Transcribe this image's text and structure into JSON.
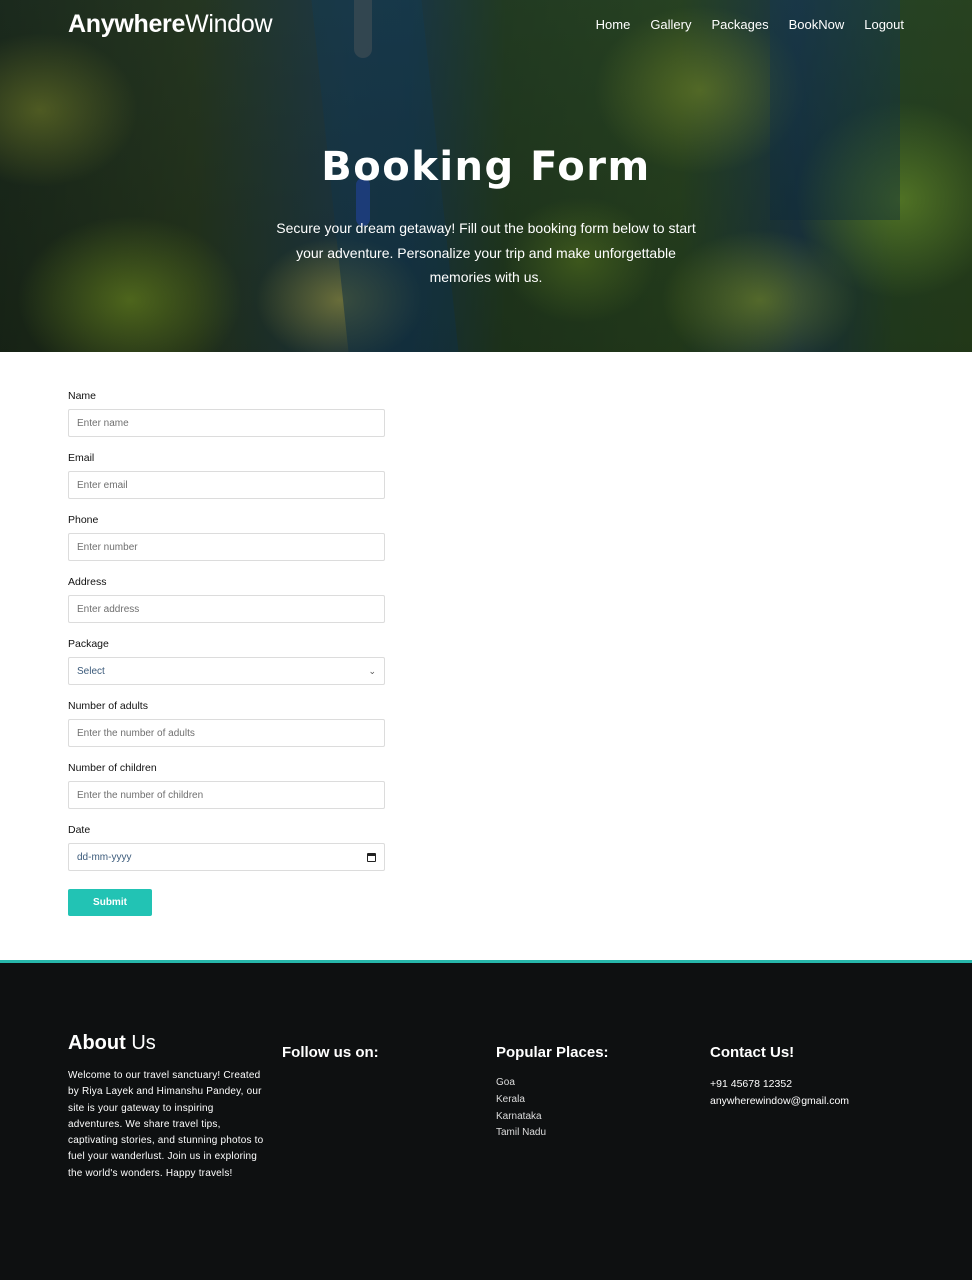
{
  "brand": {
    "bold": "Anywhere",
    "regular": "Window"
  },
  "nav": [
    "Home",
    "Gallery",
    "Packages",
    "BookNow",
    "Logout"
  ],
  "hero": {
    "title": "Booking Form",
    "text": "Secure your dream getaway! Fill out the booking form below to start your adventure. Personalize your trip and make unforgettable memories with us."
  },
  "form": {
    "name": {
      "label": "Name",
      "placeholder": "Enter name"
    },
    "email": {
      "label": "Email",
      "placeholder": "Enter email"
    },
    "phone": {
      "label": "Phone",
      "placeholder": "Enter number"
    },
    "address": {
      "label": "Address",
      "placeholder": "Enter address"
    },
    "package": {
      "label": "Package",
      "selected": "Select"
    },
    "adults": {
      "label": "Number of adults",
      "placeholder": "Enter the number of adults"
    },
    "children": {
      "label": "Number of children",
      "placeholder": "Enter the number of children"
    },
    "date": {
      "label": "Date",
      "placeholder": "dd-mm-yyyy"
    },
    "submit": "Submit"
  },
  "footer": {
    "about": {
      "title_bold": "About",
      "title_rest": " Us",
      "text": "Welcome to our travel sanctuary! Created by Riya Layek and Himanshu Pandey, our site is your gateway to inspiring adventures. We share travel tips, captivating stories, and stunning photos to fuel your wanderlust. Join us in exploring the world's wonders. Happy travels!"
    },
    "follow": {
      "title": "Follow us on:"
    },
    "places": {
      "title": "Popular Places:",
      "items": [
        "Goa",
        "Kerala",
        "Karnataka",
        "Tamil Nadu"
      ]
    },
    "contact": {
      "title": "Contact Us!",
      "phone": "+91 45678 12352",
      "email": "anywherewindow@gmail.com"
    }
  },
  "colors": {
    "accent": "#22c3b4",
    "footer_bg": "#0e1011"
  }
}
